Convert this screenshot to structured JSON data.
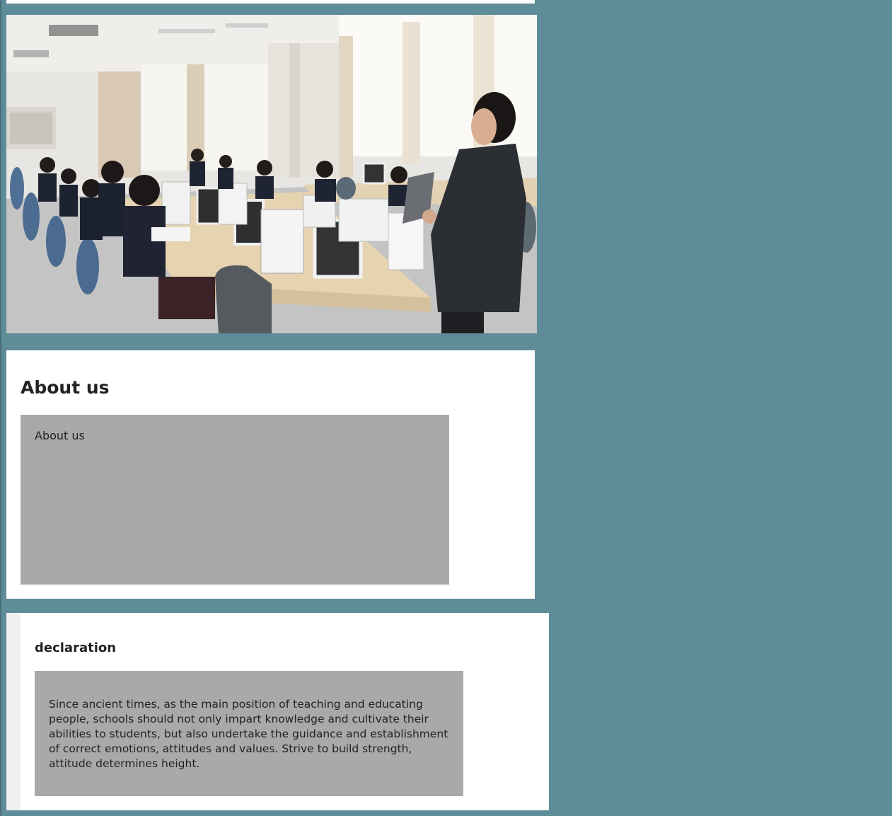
{
  "about": {
    "heading": "About us",
    "box_text": "About us"
  },
  "declaration": {
    "heading": "declaration",
    "text": "Since ancient times, as the main position of teaching and educating people, schools should not only impart knowledge and cultivate their abilities to students, but also undertake the guidance and establishment of correct emotions, attitudes and values. Strive to build strength, attitude determines height."
  },
  "colors": {
    "page_background": "#5e8c99",
    "panel_background": "#ffffff",
    "box_background": "#a9a9a9"
  }
}
